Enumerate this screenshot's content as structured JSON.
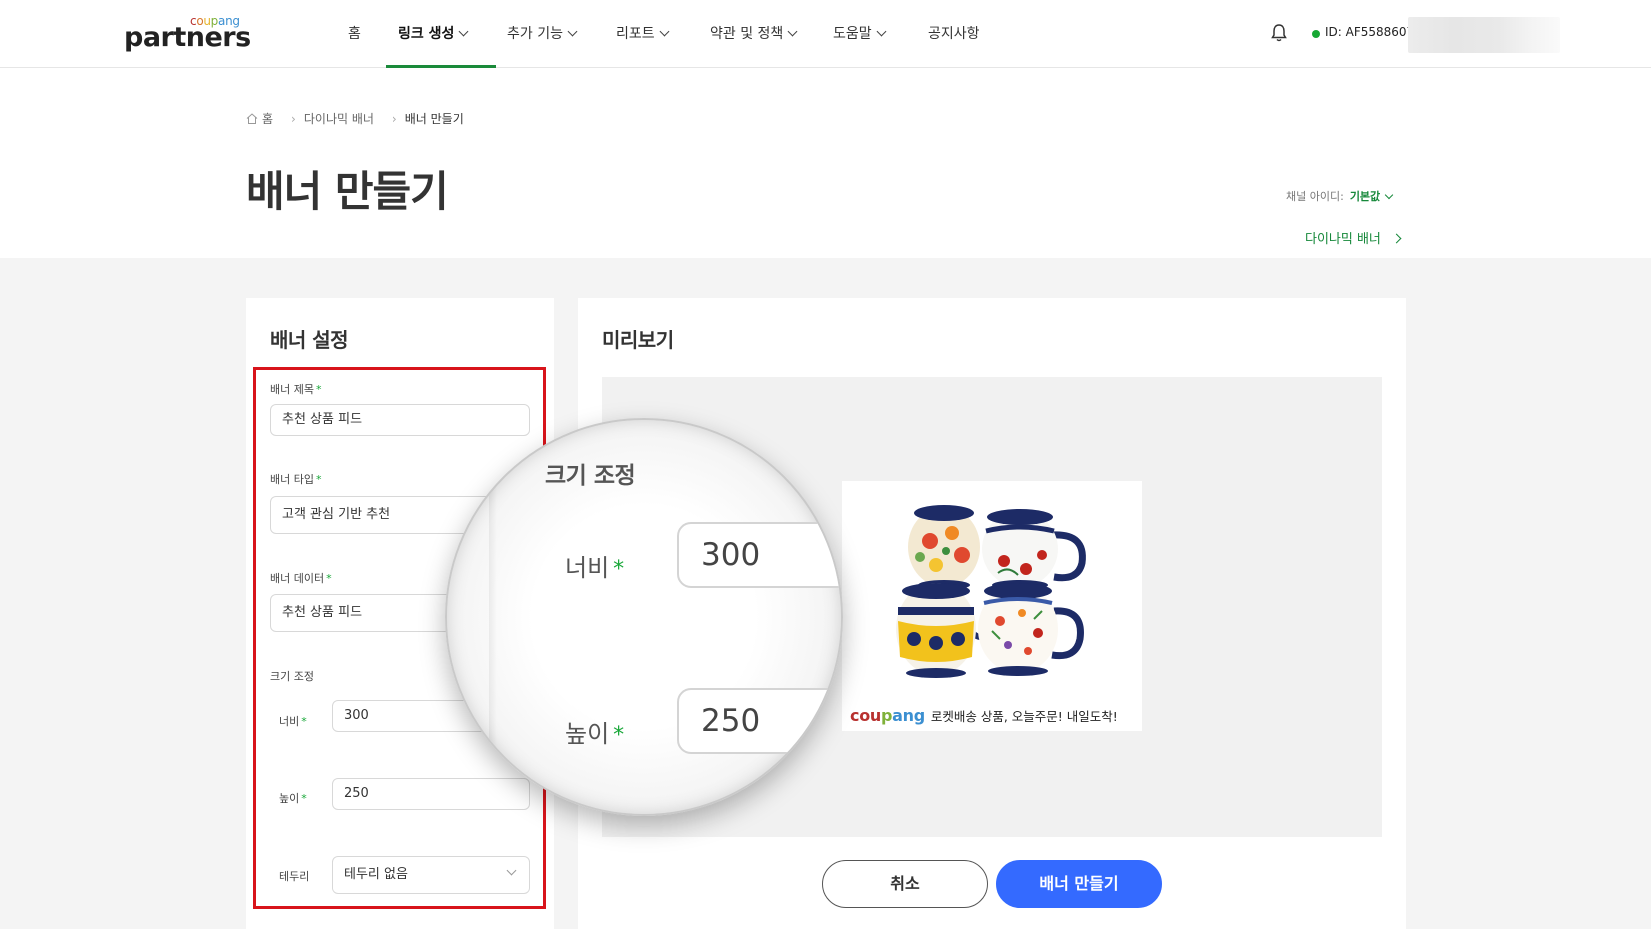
{
  "header": {
    "logo_small": "coupang",
    "logo_main": "partners",
    "nav": [
      {
        "label": "홈",
        "dropdown": false
      },
      {
        "label": "링크 생성",
        "dropdown": true,
        "active": true
      },
      {
        "label": "추가 기능",
        "dropdown": true
      },
      {
        "label": "리포트",
        "dropdown": true
      },
      {
        "label": "약관 및 정책",
        "dropdown": true
      },
      {
        "label": "도움말",
        "dropdown": true
      },
      {
        "label": "공지사항",
        "dropdown": false
      }
    ],
    "user_id": "ID: AF5588607",
    "online_color": "#17a834",
    "accent": "#1a8a3a"
  },
  "breadcrumb": [
    "홈",
    "다이나믹 배너",
    "배너 만들기"
  ],
  "page_title": "배너 만들기",
  "channel": {
    "label": "채널 아이디:",
    "value": "기본값"
  },
  "dynamic_banner_link": "다이나믹 배너",
  "settings": {
    "title": "배너 설정",
    "banner_title_label": "배너 제목",
    "banner_title_value": "추천 상품 피드",
    "banner_type_label": "배너 타입",
    "banner_type_value": "고객 관심 기반 추천",
    "banner_data_label": "배너 데이터",
    "banner_data_value": "추천 상품 피드",
    "size_label": "크기 조정",
    "width_label": "너비",
    "width_value": "300",
    "height_label": "높이",
    "height_value": "250",
    "border_label": "테두리",
    "border_value": "테두리 없음",
    "required_mark": "*"
  },
  "preview": {
    "title": "미리보기",
    "caption_brand": "coupang",
    "caption_text": "로켓배송 상품, 오늘주문! 내일도착!"
  },
  "buttons": {
    "cancel": "취소",
    "create": "배너 만들기",
    "create_color": "#346aff"
  },
  "magnifier": {
    "title": "크기 조정",
    "width_label": "너비",
    "width_value": "300",
    "height_label": "높이",
    "height_value": "250"
  },
  "highlight_color": "#d8141b"
}
